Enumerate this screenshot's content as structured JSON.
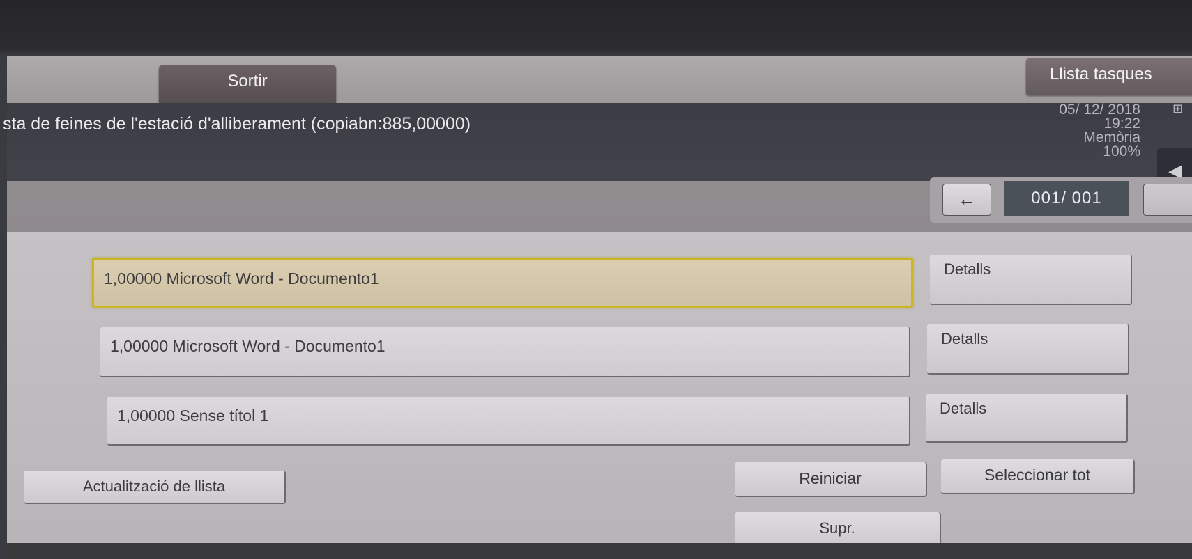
{
  "toolbar": {
    "exit_label": "Sortir",
    "job_list_label": "Llista tasques"
  },
  "header": {
    "title": "sta de feines de l'estació d'alliberament (copiabn:885,00000)",
    "date": "05/ 12/ 2018",
    "time": "19:22",
    "memory_label": "Memòria",
    "memory_value": "100%"
  },
  "pager": {
    "prev_icon": "arrow-left-icon",
    "prev_glyph": "←",
    "count": "001/ 001"
  },
  "side_tab": {
    "glyph": "◀"
  },
  "jobs": [
    {
      "label": "1,00000 Microsoft Word - Documento1",
      "selected": true,
      "details_label": "Detalls"
    },
    {
      "label": "1,00000 Microsoft Word - Documento1",
      "selected": false,
      "details_label": "Detalls"
    },
    {
      "label": "1,00000 Sense títol 1",
      "selected": false,
      "details_label": "Detalls"
    }
  ],
  "actions": {
    "refresh_list": "Actualització de llista",
    "restart": "Reiniciar",
    "select_all": "Seleccionar tot",
    "delete": "Supr."
  }
}
